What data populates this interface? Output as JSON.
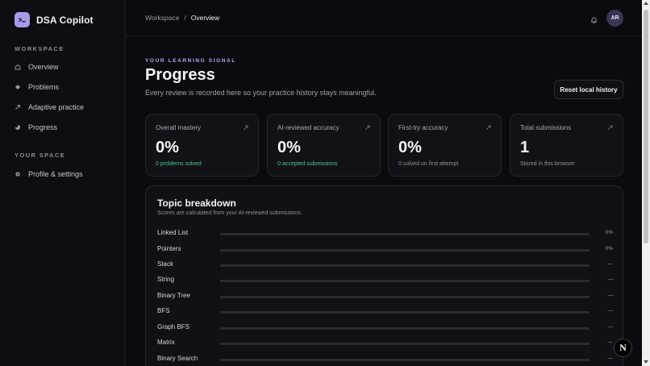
{
  "app": {
    "name": "DSA Copilot",
    "logo_icon": "terminal-icon",
    "accent": "#a59be8"
  },
  "sidebar": {
    "workspace_label": "WORKSPACE",
    "items": [
      {
        "label": "Overview",
        "icon": "home-icon"
      },
      {
        "label": "Problems",
        "icon": "diamond-icon"
      },
      {
        "label": "Adaptive practice",
        "icon": "arrow-up-right-icon"
      },
      {
        "label": "Progress",
        "icon": "pie-icon"
      }
    ],
    "space_label": "YOUR SPACE",
    "space_items": [
      {
        "label": "Profile & settings",
        "icon": "gear-icon"
      }
    ]
  },
  "breadcrumb": {
    "root": "Workspace",
    "separator": "/",
    "current": "Overview"
  },
  "user": {
    "initials": "AR"
  },
  "page": {
    "eyebrow": "YOUR LEARNING SIGNAL",
    "title": "Progress",
    "subtitle": "Every review is recorded here so your practice history stays meaningful.",
    "reset_label": "Reset local history"
  },
  "stats": [
    {
      "label": "Overall mastery",
      "value": "0%",
      "sub": "0 problems solved",
      "sub_color": "#4fc48a"
    },
    {
      "label": "AI-reviewed accuracy",
      "value": "0%",
      "sub": "0 accepted submissions",
      "sub_color": "#4fc48a"
    },
    {
      "label": "First-try accuracy",
      "value": "0%",
      "sub": "0 solved on first attempt",
      "sub_color": "#8f8f9a"
    },
    {
      "label": "Total submissions",
      "value": "1",
      "sub": "Stored in this browser",
      "sub_color": "#8f8f9a"
    }
  ],
  "topics": {
    "title": "Topic breakdown",
    "subtitle": "Scores are calculated from your AI-reviewed submissions.",
    "rows": [
      {
        "name": "Linked List",
        "value": "0%",
        "fraction": 0
      },
      {
        "name": "Pointers",
        "value": "0%",
        "fraction": 0
      },
      {
        "name": "Stack",
        "value": "—",
        "fraction": 0
      },
      {
        "name": "String",
        "value": "—",
        "fraction": 0
      },
      {
        "name": "Binary Tree",
        "value": "—",
        "fraction": 0
      },
      {
        "name": "BFS",
        "value": "—",
        "fraction": 0
      },
      {
        "name": "Graph BFS",
        "value": "—",
        "fraction": 0
      },
      {
        "name": "Matrix",
        "value": "—",
        "fraction": 0
      },
      {
        "name": "Binary Search",
        "value": "—",
        "fraction": 0
      }
    ]
  },
  "fab": {
    "label": "N"
  }
}
